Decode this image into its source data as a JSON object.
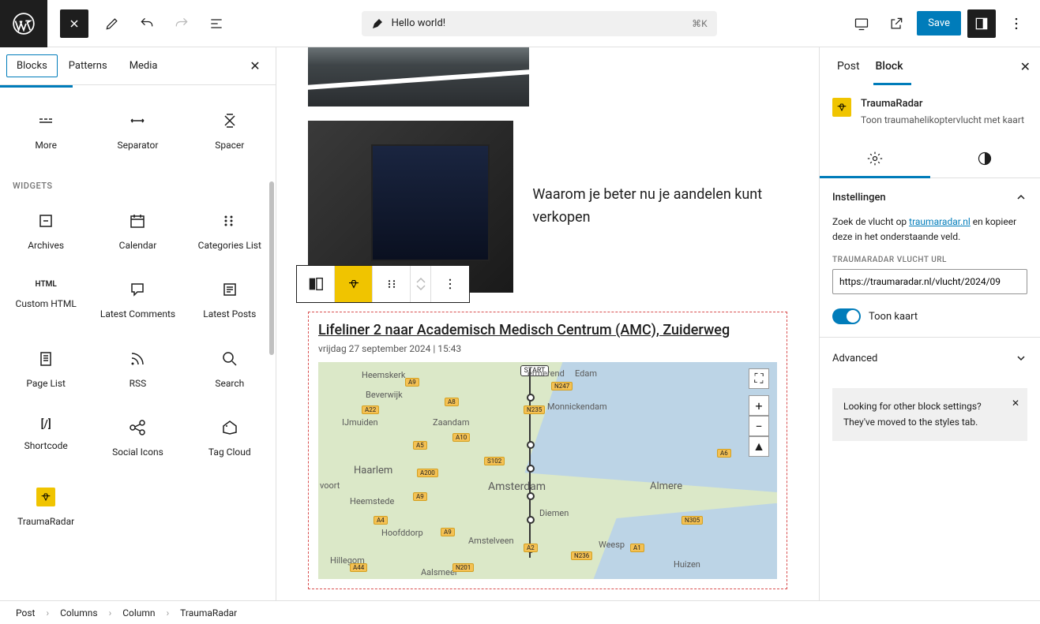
{
  "header": {
    "title": "Hello world!",
    "shortcut": "⌘K",
    "save_label": "Save"
  },
  "inserter": {
    "tabs": [
      "Blocks",
      "Patterns",
      "Media"
    ],
    "section_heading": "WIDGETS",
    "design_blocks": [
      {
        "label": "More"
      },
      {
        "label": "Separator"
      },
      {
        "label": "Spacer"
      }
    ],
    "widget_blocks": [
      {
        "label": "Archives"
      },
      {
        "label": "Calendar"
      },
      {
        "label": "Categories List"
      },
      {
        "label": "Custom HTML"
      },
      {
        "label": "Latest Comments"
      },
      {
        "label": "Latest Posts"
      },
      {
        "label": "Page List"
      },
      {
        "label": "RSS"
      },
      {
        "label": "Search"
      },
      {
        "label": "Shortcode"
      },
      {
        "label": "Social Icons"
      },
      {
        "label": "Tag Cloud"
      },
      {
        "label": "TraumaRadar"
      }
    ]
  },
  "canvas": {
    "caption": "Waarom je beter nu je aandelen kunt verkopen",
    "selected": {
      "title": "Lifeliner 2 naar Academisch Medisch Centrum (AMC), Zuiderweg",
      "date": "vrijdag 27 september 2024 | 15:43",
      "start_label": "START",
      "map_labels": [
        "Heemskerk",
        "Beverwijk",
        "IJmuiden",
        "Zaandam",
        "Haarlem",
        "Heemstede",
        "Hoofddorp",
        "Hillegom",
        "Amstelveen",
        "Amsterdam",
        "Diemen",
        "Monnickendam",
        "Edam",
        "Weesp",
        "Almere",
        "Huizen",
        "voort",
        "Aalsmeer",
        "ermerend"
      ],
      "roads": [
        "A9",
        "A8",
        "A5",
        "A10",
        "A4",
        "A44",
        "A200",
        "S102",
        "N201",
        "N236",
        "A1",
        "A6",
        "N305",
        "A9",
        "A2",
        "A9",
        "A22",
        "N247",
        "N235"
      ]
    }
  },
  "sidebar": {
    "tabs": [
      "Post",
      "Block"
    ],
    "block": {
      "name": "TraumaRadar",
      "desc": "Toon traumahelikoptervlucht met kaart"
    },
    "settings": {
      "heading": "Instellingen",
      "help_pre": "Zoek de vlucht op ",
      "help_link": "traumaradar.nl",
      "help_post": " en kopieer deze in het onderstaande veld.",
      "url_label": "TRAUMARADAR VLUCHT URL",
      "url_value": "https://traumaradar.nl/vlucht/2024/09",
      "toggle_label": "Toon kaart"
    },
    "advanced": "Advanced",
    "notice": "Looking for other block settings? They've moved to the styles tab."
  },
  "breadcrumb": [
    "Post",
    "Columns",
    "Column",
    "TraumaRadar"
  ]
}
